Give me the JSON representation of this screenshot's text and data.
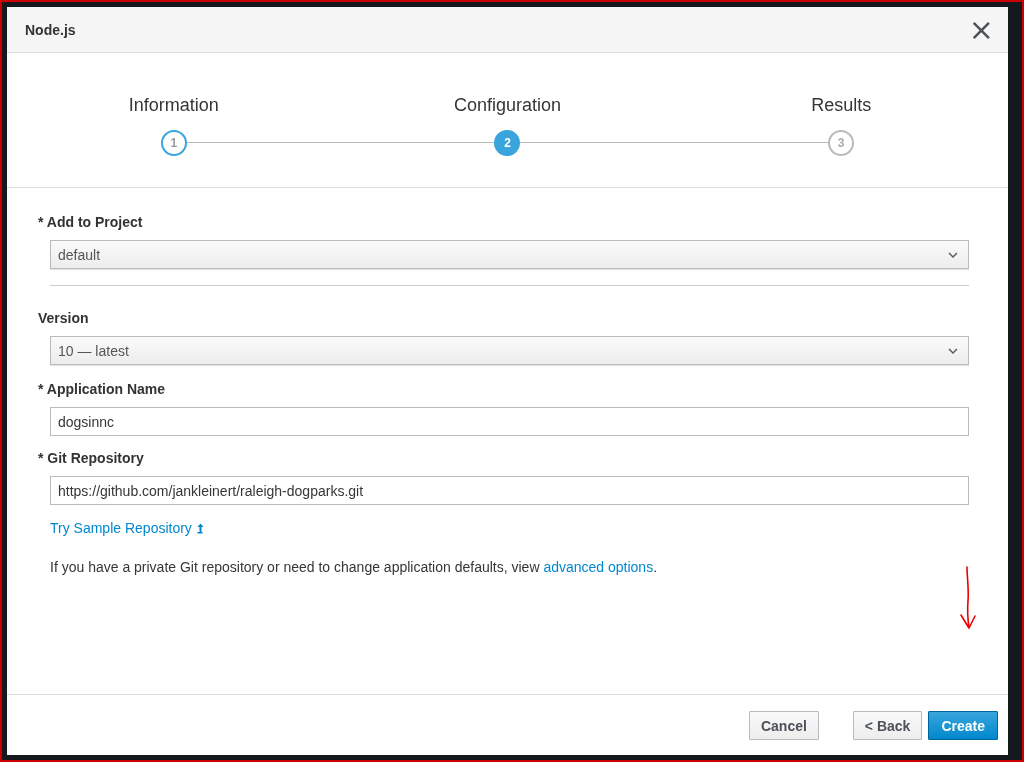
{
  "dialog": {
    "title": "Node.js",
    "close_symbol": "×"
  },
  "steps": [
    {
      "label": "Information",
      "number": "1",
      "selected": false,
      "completed": true
    },
    {
      "label": "Configuration",
      "number": "2",
      "selected": true,
      "completed": false
    },
    {
      "label": "Results",
      "number": "3",
      "selected": false,
      "completed": false
    }
  ],
  "fields": [
    {
      "kind": "select",
      "label": "* Add to Project",
      "value": "default"
    },
    {
      "kind": "divider"
    },
    {
      "kind": "select",
      "label": "Version",
      "value": "10 — latest"
    },
    {
      "kind": "input",
      "label": "* Application Name",
      "value": "dogsinnc"
    },
    {
      "kind": "input",
      "label": "* Git Repository",
      "value": "https://github.com/jankleinert/raleigh-dogparks.git"
    }
  ],
  "sample_link": "Try Sample Repository",
  "help": {
    "text": "If you have a private Git repository or need to change application defaults, view ",
    "link": "advanced options",
    "suffix": "."
  },
  "buttons": [
    {
      "label": "Cancel",
      "kind": "default"
    },
    {
      "label": "< Back",
      "kind": "default"
    },
    {
      "label": "Create",
      "kind": "primary"
    }
  ]
}
